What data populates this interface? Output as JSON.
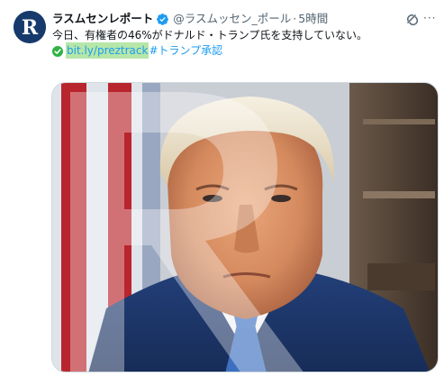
{
  "tweet": {
    "author_name": "ラスムセンレポート",
    "handle": "@ラスムッセン_ポール",
    "separator": "·",
    "time": "5時間",
    "text_line1": "今日、有権者の46%がドナルド・トランプ氏を支持していない。",
    "link_text": "bit.ly/preztrack",
    "hashtag_text": "#トランプ承認",
    "avatar_letter": "R",
    "more_label": "···"
  },
  "icons": {
    "verified": "verified-badge-icon",
    "grok": "grok-icon",
    "check": "check-mark-emoji-icon",
    "more": "more-options-icon"
  },
  "colors": {
    "accent": "#1d9bf0",
    "link_highlight": "#b6e7a8",
    "muted": "#536471",
    "avatar_bg": "#163a6b",
    "check_green": "#2fb344"
  }
}
